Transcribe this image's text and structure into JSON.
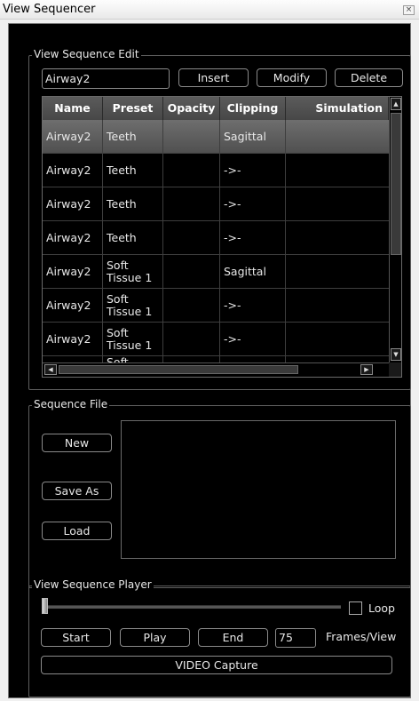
{
  "window": {
    "title": "View Sequencer",
    "close_glyph": "×"
  },
  "edit": {
    "group_title": "View Sequence Edit",
    "name_value": "Airway2",
    "insert_label": "Insert",
    "modify_label": "Modify",
    "delete_label": "Delete",
    "columns": [
      "Name",
      "Preset",
      "Opacity",
      "Clipping",
      "Simulation"
    ],
    "rows": [
      {
        "name": "Airway2",
        "preset": "Teeth",
        "opacity": "",
        "clipping": "Sagittal",
        "simulation": ""
      },
      {
        "name": "Airway2",
        "preset": "Teeth",
        "opacity": "",
        "clipping": "->-",
        "simulation": ""
      },
      {
        "name": "Airway2",
        "preset": "Teeth",
        "opacity": "",
        "clipping": "->-",
        "simulation": ""
      },
      {
        "name": "Airway2",
        "preset": "Teeth",
        "opacity": "",
        "clipping": "->-",
        "simulation": ""
      },
      {
        "name": "Airway2",
        "preset": "Soft Tissue 1",
        "opacity": "",
        "clipping": "Sagittal",
        "simulation": ""
      },
      {
        "name": "Airway2",
        "preset": "Soft Tissue 1",
        "opacity": "",
        "clipping": "->-",
        "simulation": ""
      },
      {
        "name": "Airway2",
        "preset": "Soft Tissue 1",
        "opacity": "",
        "clipping": "->-",
        "simulation": ""
      },
      {
        "name": "",
        "preset": "Soft",
        "opacity": "",
        "clipping": "",
        "simulation": ""
      }
    ],
    "selected_row": 0
  },
  "file": {
    "group_title": "Sequence File",
    "new_label": "New",
    "save_as_label": "Save As",
    "load_label": "Load"
  },
  "player": {
    "group_title": "View Sequence Player",
    "slider_value": 0,
    "loop_label": "Loop",
    "loop_checked": false,
    "start_label": "Start",
    "play_label": "Play",
    "end_label": "End",
    "frames_value": "75",
    "frames_label": "Frames/View",
    "capture_label": "VIDEO Capture"
  }
}
